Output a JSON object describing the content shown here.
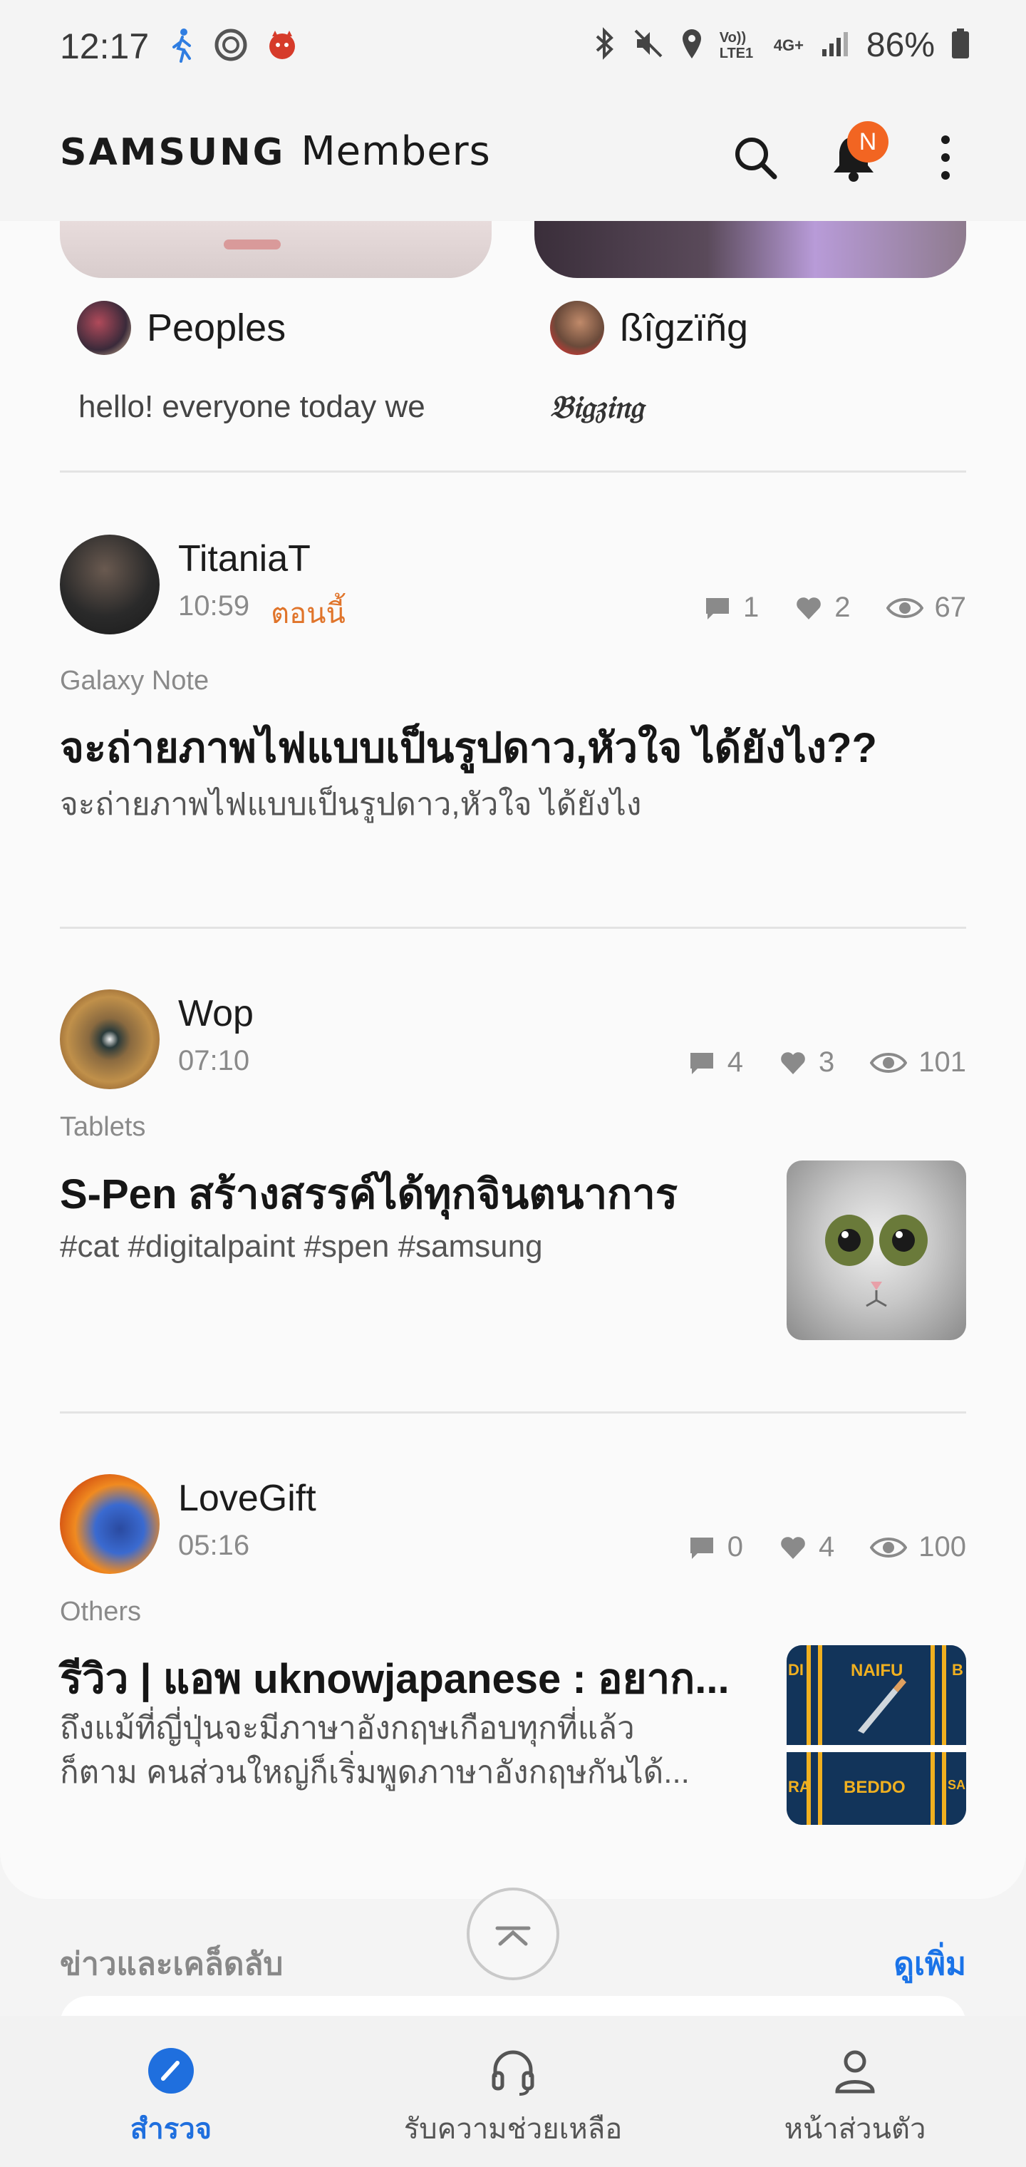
{
  "status_bar": {
    "time": "12:17",
    "battery": "86%",
    "left_icons": [
      "walking-icon",
      "antutu-icon",
      "devil-icon"
    ],
    "right_icons": [
      "bluetooth-icon",
      "mute-icon",
      "location-icon",
      "volte-icon",
      "4g-icon",
      "signal-icon",
      "battery-icon"
    ],
    "volte_label": "Vo)) LTE1",
    "network_label": "4G+"
  },
  "app_bar": {
    "brand_samsung": "SAMSUNG",
    "brand_members": "Members",
    "notification_badge": "N"
  },
  "previews": [
    {
      "name": "Peoples",
      "text": "hello! everyone today we"
    },
    {
      "name": "ßîgzïñg",
      "text": "𝔅𝔦𝔤𝔷𝔦𝔫𝔤"
    }
  ],
  "posts": [
    {
      "author": "TitaniaT",
      "time": "10:59",
      "time_note": "ตอนนี้",
      "comments": "1",
      "likes": "2",
      "views": "67",
      "category": "Galaxy Note",
      "title": "จะถ่ายภาพไฟแบบเป็นรูปดาว,หัวใจ ได้ยังไง??",
      "body": "จะถ่ายภาพไฟแบบเป็นรูปดาว,หัวใจ ได้ยังไง"
    },
    {
      "author": "Wop",
      "time": "07:10",
      "comments": "4",
      "likes": "3",
      "views": "101",
      "category": "Tablets",
      "title": "S-Pen สร้างสรรค์ได้ทุกจินตนาการ",
      "body": "#cat #digitalpaint #spen #samsung"
    },
    {
      "author": "LoveGift",
      "time": "05:16",
      "comments": "0",
      "likes": "4",
      "views": "100",
      "category": "Others",
      "title": "รีวิว | แอพ uknowjapanese : อยาก...",
      "body_line1": "ถึงแม้ที่ญี่ปุ่นจะมีภาษาอังกฤษเกือบทุกที่แล้ว",
      "body_line2": "ก็ตาม คนส่วนใหญ่ก็เริ่มพูดภาษาอังกฤษกันได้...",
      "thumb_text_top": "NAIFU",
      "thumb_text_bottom": "BEDDO",
      "thumb_side_left_top": "DI",
      "thumb_side_left_bottom": "RA",
      "thumb_side_right_top": "B",
      "thumb_side_right_bottom": "SA"
    }
  ],
  "news": {
    "header": "ข่าวและเคล็ดลับ",
    "more": "ดูเพิ่ม"
  },
  "bottom_nav": [
    {
      "label": "สำรวจ",
      "icon": "compass-icon",
      "active": true
    },
    {
      "label": "รับความช่วยเหลือ",
      "icon": "headset-icon",
      "active": false
    },
    {
      "label": "หน้าส่วนตัว",
      "icon": "person-icon",
      "active": false
    }
  ],
  "colors": {
    "accent_blue": "#1f6fde",
    "badge_orange": "#f26522",
    "time_note_orange": "#e0742a"
  }
}
